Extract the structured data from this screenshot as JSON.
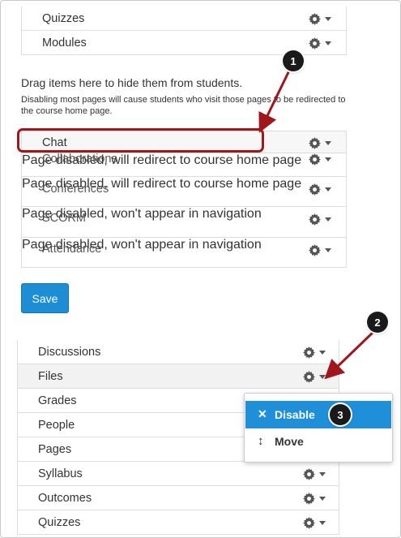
{
  "top_nav": {
    "items": [
      {
        "label": "Quizzes"
      },
      {
        "label": "Modules"
      }
    ]
  },
  "hidden_section": {
    "title": "Drag items here to hide them from students.",
    "description": "Disabling most pages will cause students who visit those pages to be redirected to the course home page.",
    "items": [
      {
        "label": "Chat",
        "note": ""
      },
      {
        "label": "Collaborations",
        "note": "Page disabled, will redirect to course home page"
      },
      {
        "label": "Conferences",
        "note": "Page disabled, will redirect to course home page"
      },
      {
        "label": "SCORM",
        "note": "Page disabled, won't appear in navigation"
      },
      {
        "label": "Attendance",
        "note": "Page disabled, won't appear in navigation"
      }
    ]
  },
  "save_label": "Save",
  "nav2": {
    "items": [
      {
        "label": "Discussions"
      },
      {
        "label": "Files"
      },
      {
        "label": "Grades"
      },
      {
        "label": "People"
      },
      {
        "label": "Pages"
      },
      {
        "label": "Syllabus"
      },
      {
        "label": "Outcomes"
      },
      {
        "label": "Quizzes"
      }
    ]
  },
  "menu": {
    "disable_label": "Disable",
    "move_label": "Move",
    "disable_icon": "close-icon",
    "move_icon": "move-vertical-icon"
  },
  "callouts": [
    "1",
    "2",
    "3"
  ],
  "colors": {
    "accent": "#1d8dd6",
    "annotation": "#a0161b"
  }
}
